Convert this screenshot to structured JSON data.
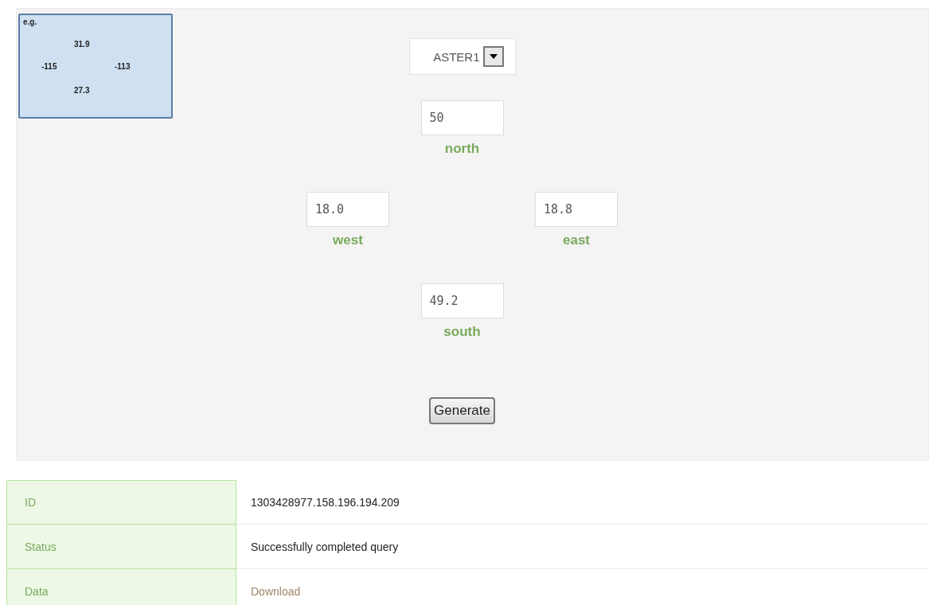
{
  "example": {
    "label": "e.g.",
    "north": "31.9",
    "west": "-115",
    "east": "-113",
    "south": "27.3"
  },
  "form": {
    "dataset": "ASTER1",
    "north": {
      "value": "50",
      "label": "north"
    },
    "west": {
      "value": "18.0",
      "label": "west"
    },
    "east": {
      "value": "18.8",
      "label": "east"
    },
    "south": {
      "value": "49.2",
      "label": "south"
    },
    "button": "Generate"
  },
  "results": [
    {
      "label": "ID",
      "value": "1303428977.158.196.194.209",
      "kind": "text"
    },
    {
      "label": "Status",
      "value": "Successfully completed query",
      "kind": "text"
    },
    {
      "label": "Data",
      "value": "Download",
      "kind": "link"
    }
  ]
}
